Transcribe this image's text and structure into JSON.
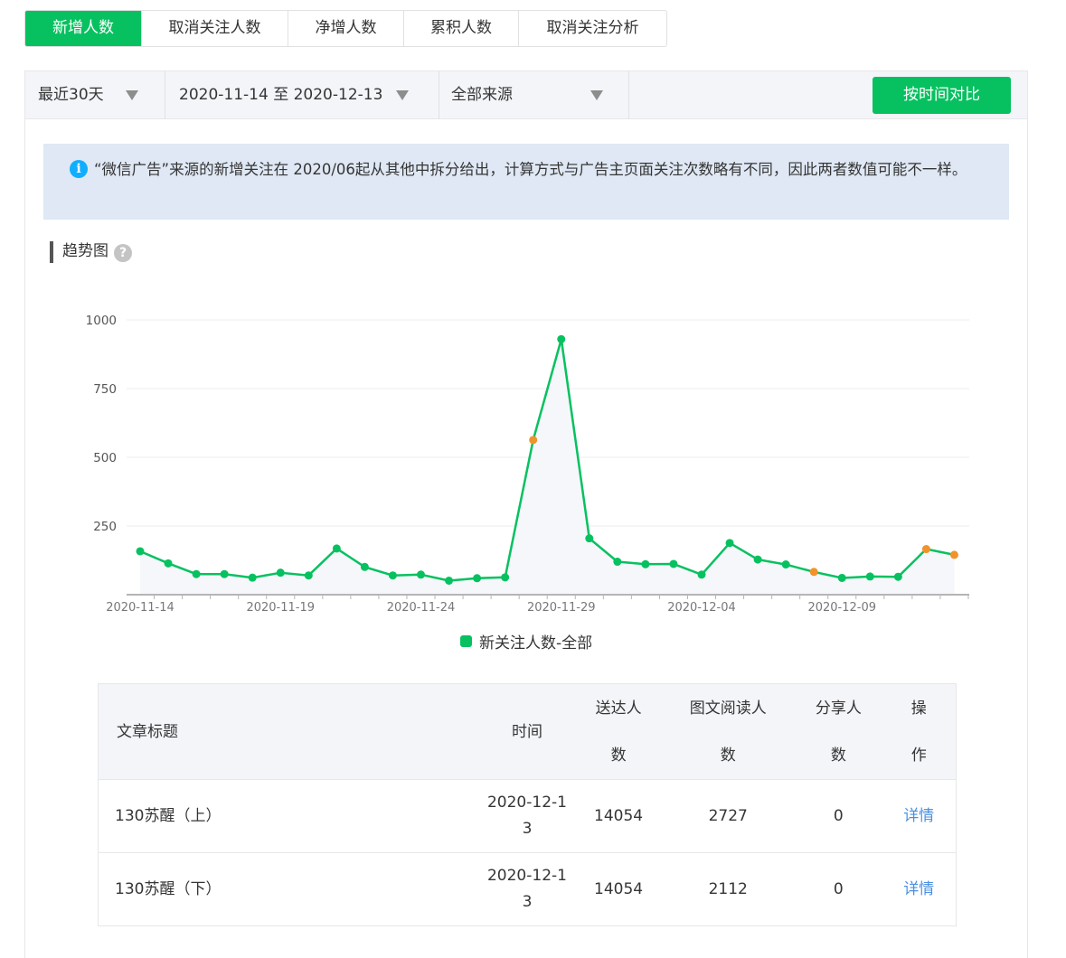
{
  "tabs": [
    {
      "label": "新增人数",
      "active": true
    },
    {
      "label": "取消关注人数",
      "active": false
    },
    {
      "label": "净增人数",
      "active": false
    },
    {
      "label": "累积人数",
      "active": false
    },
    {
      "label": "取消关注分析",
      "active": false
    }
  ],
  "filters": {
    "period": "最近30天",
    "date_range": "2020-11-14 至 2020-12-13",
    "source": "全部来源",
    "compare_button": "按时间对比"
  },
  "notice": {
    "icon": "info-icon",
    "text": "“微信广告”来源的新增关注在 2020/06起从其他中拆分给出，计算方式与广告主页面关注次数略有不同，因此两者数值可能不一样。"
  },
  "trend": {
    "title": "趋势图",
    "help_icon": "?"
  },
  "chart_data": {
    "type": "line",
    "y_ticks": [
      "1000",
      "750",
      "500",
      "250"
    ],
    "ylim": [
      0,
      1000
    ],
    "x_tick_labels": [
      "2020-11-14",
      "2020-11-19",
      "2020-11-24",
      "2020-11-29",
      "2020-12-04",
      "2020-12-09"
    ],
    "x": [
      "2020-11-14",
      "2020-11-15",
      "2020-11-16",
      "2020-11-17",
      "2020-11-18",
      "2020-11-19",
      "2020-11-20",
      "2020-11-21",
      "2020-11-22",
      "2020-11-23",
      "2020-11-24",
      "2020-11-25",
      "2020-11-26",
      "2020-11-27",
      "2020-11-28",
      "2020-11-29",
      "2020-11-30",
      "2020-12-01",
      "2020-12-02",
      "2020-12-03",
      "2020-12-04",
      "2020-12-05",
      "2020-12-06",
      "2020-12-07",
      "2020-12-08",
      "2020-12-09",
      "2020-12-10",
      "2020-12-11",
      "2020-12-12",
      "2020-12-13"
    ],
    "series": [
      {
        "name": "新关注人数-全部",
        "color": "#07c160",
        "values": [
          158,
          114,
          75,
          75,
          62,
          80,
          70,
          168,
          101,
          70,
          73,
          51,
          60,
          63,
          563,
          930,
          205,
          120,
          111,
          112,
          73,
          188,
          128,
          110,
          83,
          61,
          66,
          65,
          166,
          145
        ]
      }
    ],
    "highlight_color": "#f0932b",
    "highlight_points": [
      14,
      24,
      28,
      29
    ],
    "grid": true
  },
  "table": {
    "headers": {
      "title": "文章标题",
      "time": "时间",
      "delivered": "送达人数",
      "readers": "图文阅读人数",
      "sharers": "分享人数",
      "action": "操作"
    },
    "rows": [
      {
        "title": "130苏醒（上）",
        "time": "2020-12-13",
        "delivered": "14054",
        "readers": "2727",
        "sharers": "0",
        "action": "详情"
      },
      {
        "title": "130苏醒（下）",
        "time": "2020-12-13",
        "delivered": "14054",
        "readers": "2112",
        "sharers": "0",
        "action": "详情"
      }
    ]
  }
}
